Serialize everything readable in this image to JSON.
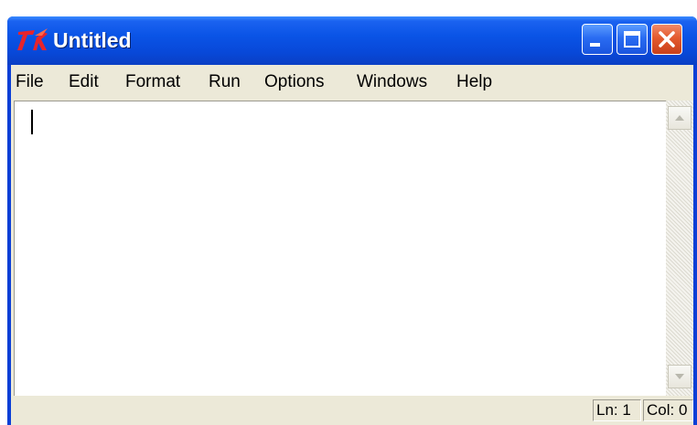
{
  "window": {
    "title": "Untitled",
    "icon": "tk-feather-icon",
    "controls": [
      "minimize-icon",
      "maximize-icon",
      "close-icon"
    ]
  },
  "menubar": {
    "items": [
      {
        "label": "File"
      },
      {
        "label": "Edit"
      },
      {
        "label": "Format"
      },
      {
        "label": "Run"
      },
      {
        "label": "Options"
      },
      {
        "label": "Windows"
      },
      {
        "label": "Help"
      }
    ]
  },
  "editor": {
    "content": ""
  },
  "statusbar": {
    "line": "Ln: 1",
    "column": "Col: 0"
  },
  "colors": {
    "titlebar": "#0a54e6",
    "title_text": "#ffffff",
    "close_button": "#e45a2e",
    "chrome": "#ece9d8",
    "editor_bg": "#ffffff"
  }
}
